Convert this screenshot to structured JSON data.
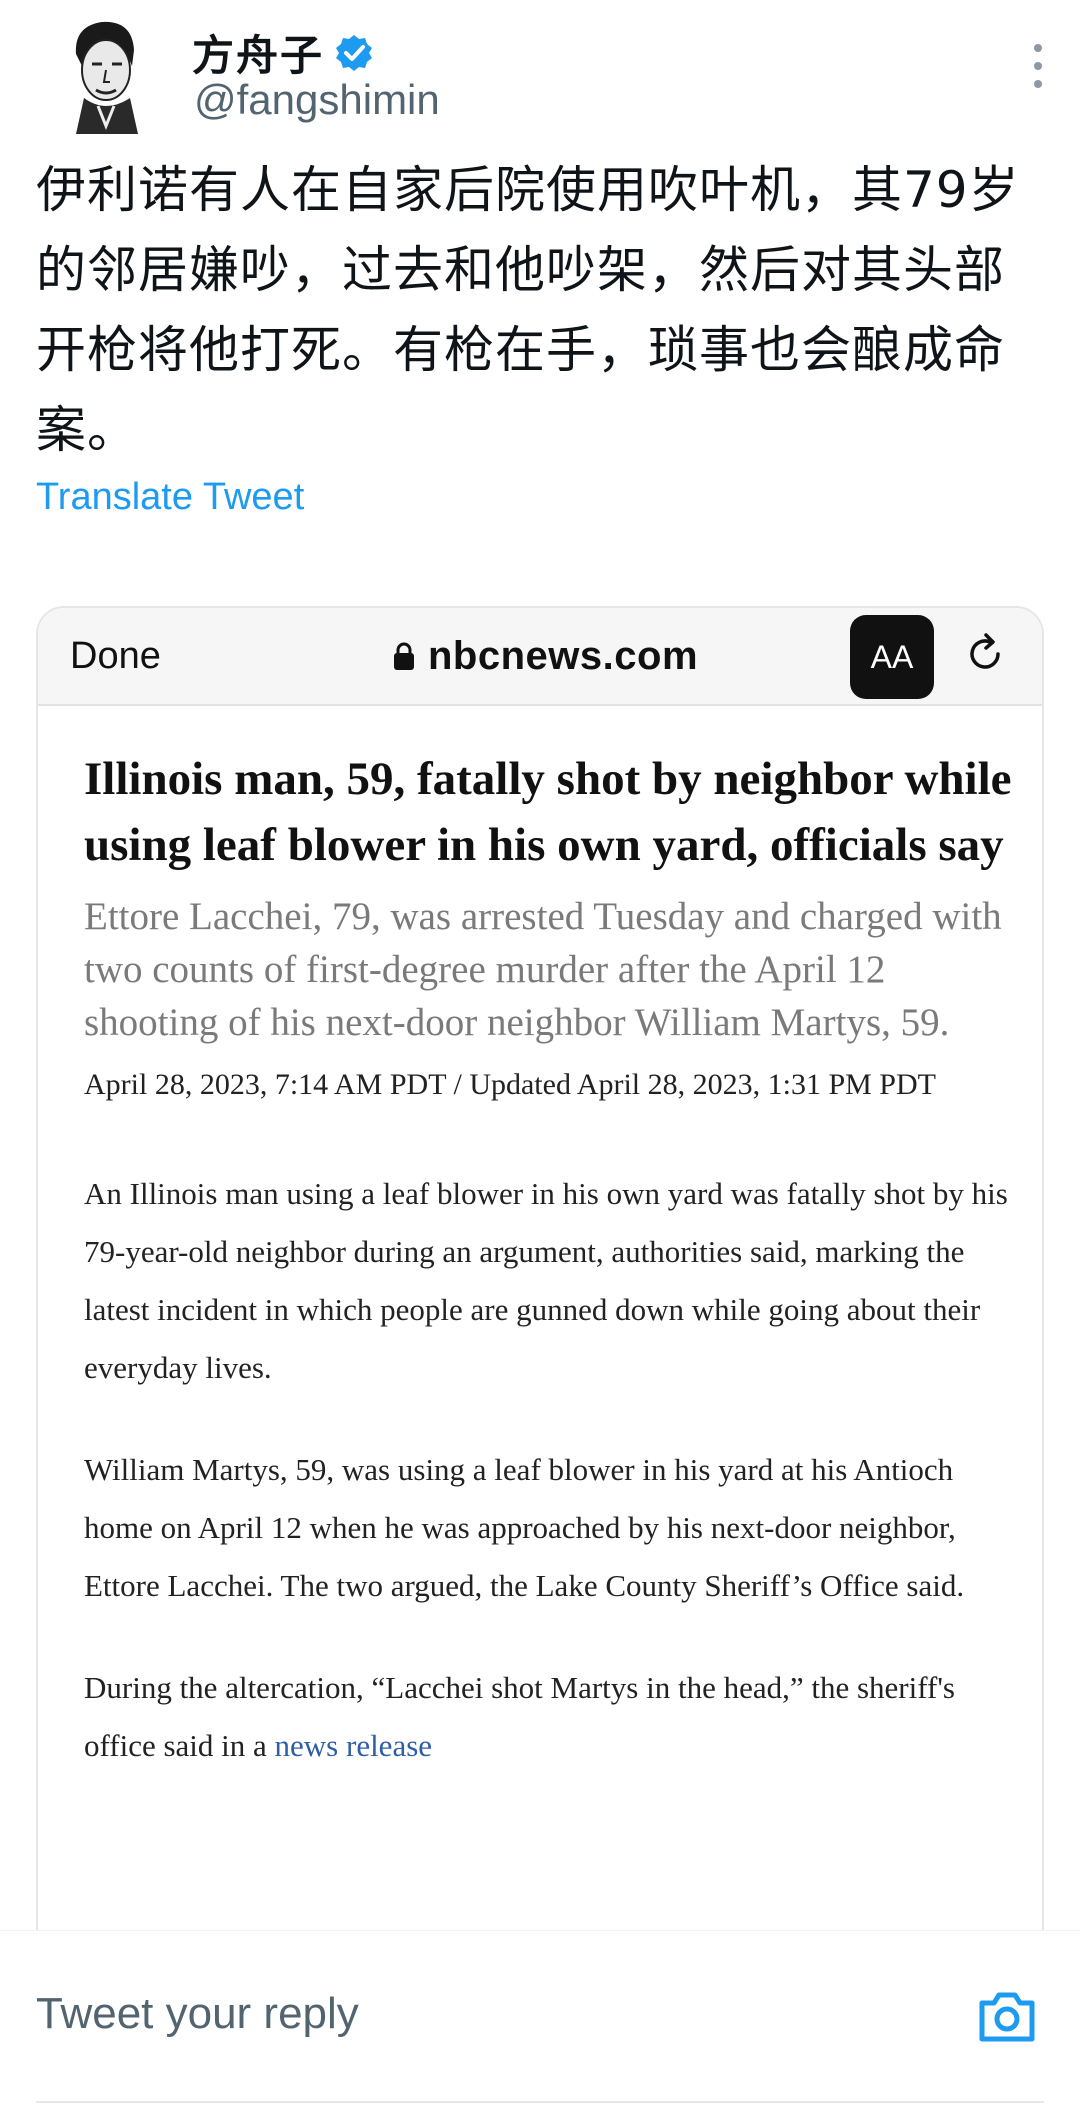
{
  "tweet": {
    "display_name": "方舟子",
    "handle": "@fangshimin",
    "text": "伊利诺有人在自家后院使用吹叶机，其79岁的邻居嫌吵，过去和他吵架，然后对其头部开枪将他打死。有枪在手，琐事也会酿成命案。",
    "translate_label": "Translate Tweet",
    "verified_color": "#1d9bf0"
  },
  "browser": {
    "done_label": "Done",
    "url": "nbcnews.com",
    "text_size_label": "AA"
  },
  "article": {
    "headline": "Illinois man, 59, fatally shot by neighbor while using leaf blower in his own yard, officials say",
    "dek": "Ettore Lacchei, 79, was arrested Tuesday and charged with two counts of first-degree murder after the April 12 shooting of his next-door neighbor William Martys, 59.",
    "dateline": "April 28, 2023, 7:14 AM PDT / Updated April 28, 2023, 1:31 PM PDT",
    "paragraphs": [
      "An Illinois man using a leaf blower in his own yard was fatally shot by his 79-year-old neighbor during an argument, authorities said, marking the latest incident in which people are gunned down while going about their everyday lives.",
      "William Martys, 59, was using a leaf blower in his yard at his Antioch home on April 12 when he was approached by his next-door neighbor, Ettore Lacchei. The two argued, the Lake County Sheriff’s Office said."
    ],
    "para3_text": "During the altercation, “Lacchei shot Martys in the head,” the sheriff's office said in a ",
    "para3_link": "news release"
  },
  "reply": {
    "placeholder": "Tweet your reply"
  },
  "icons": {
    "more": "more-vertical-icon",
    "verified": "verified-badge-icon",
    "lock": "lock-icon",
    "reload": "reload-icon",
    "camera": "camera-icon"
  }
}
